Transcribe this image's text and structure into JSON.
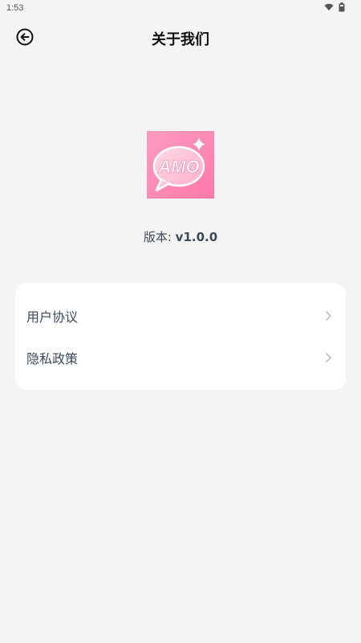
{
  "status_bar": {
    "time": "1:53",
    "icons": [
      "wifi-icon",
      "battery-icon"
    ]
  },
  "header": {
    "title": "关于我们",
    "back_icon": "back-arrow-circle-icon"
  },
  "app": {
    "logo_text": "AMO",
    "version_label": "版本:",
    "version_value": "v1.0.0"
  },
  "menu": {
    "items": [
      {
        "label": "用户协议",
        "icon": "chevron-right-icon"
      },
      {
        "label": "隐私政策",
        "icon": "chevron-right-icon"
      }
    ]
  },
  "colors": {
    "background": "#f4f4f4",
    "card": "#ffffff",
    "logo_pink": "#ff8db5",
    "text_secondary": "#3d4a5c"
  }
}
